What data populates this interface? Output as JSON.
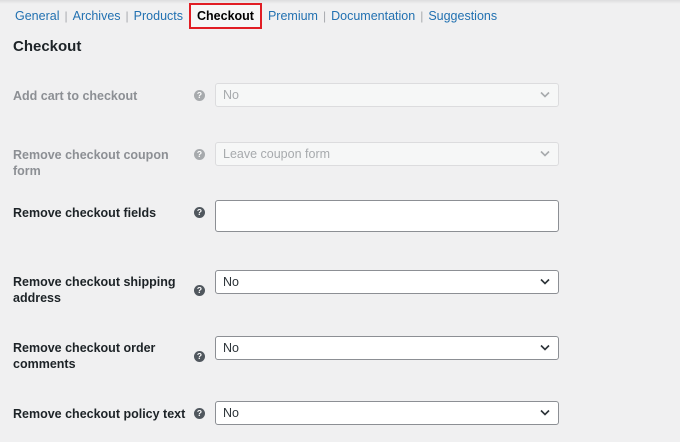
{
  "tabs": [
    {
      "label": "General",
      "current": false
    },
    {
      "label": "Archives",
      "current": false
    },
    {
      "label": "Products",
      "current": false
    },
    {
      "label": "Checkout",
      "current": true
    },
    {
      "label": "Premium",
      "current": false
    },
    {
      "label": "Documentation",
      "current": false
    },
    {
      "label": "Suggestions",
      "current": false
    }
  ],
  "tab_separator": "|",
  "page_title": "Checkout",
  "help_icon_glyph": "?",
  "colors": {
    "link": "#2271b1",
    "highlight_outline": "#e11d24",
    "background": "#f0f0f1",
    "disabled_text": "#a7aaad"
  },
  "settings": [
    {
      "label": "Add cart to checkout",
      "control": "select",
      "value": "No",
      "disabled": true
    },
    {
      "label": "Remove checkout coupon form",
      "control": "select",
      "value": "Leave coupon form",
      "disabled": true
    },
    {
      "label": "Remove checkout fields",
      "control": "text",
      "value": "",
      "disabled": false
    },
    {
      "label": "Remove checkout shipping address",
      "control": "select",
      "value": "No",
      "disabled": false
    },
    {
      "label": "Remove checkout order comments",
      "control": "select",
      "value": "No",
      "disabled": false
    },
    {
      "label": "Remove checkout policy text",
      "control": "select",
      "value": "No",
      "disabled": false
    }
  ]
}
